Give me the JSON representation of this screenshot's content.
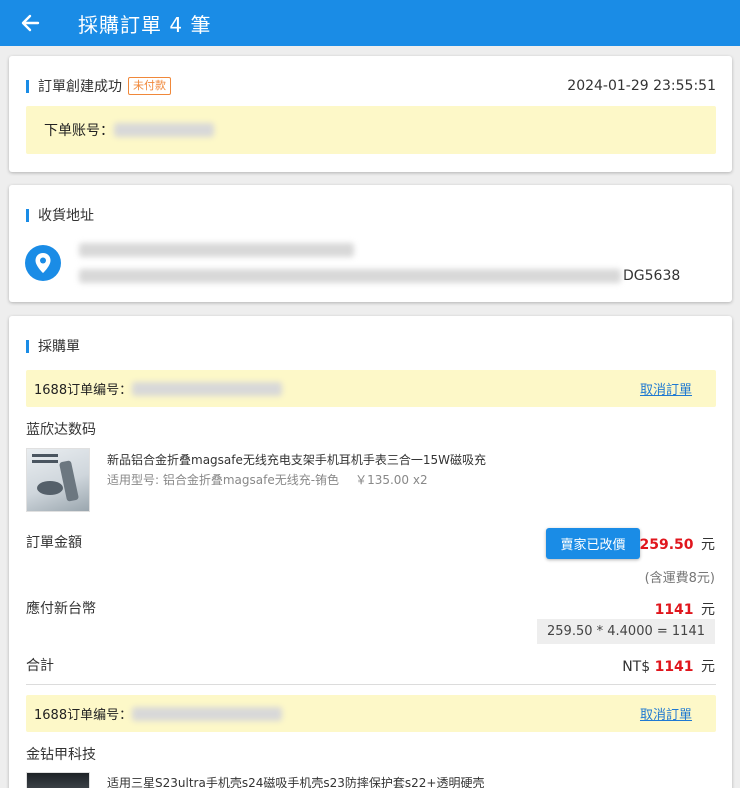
{
  "header": {
    "title": "採購訂單 4 筆"
  },
  "order": {
    "status_label": "訂單創建成功",
    "status_badge": "未付款",
    "datetime": "2024-01-29 23:55:51",
    "account_label": "下单账号："
  },
  "address": {
    "section_title": "收貨地址",
    "suffix": "DG5638"
  },
  "purchase": {
    "section_title": "採購單",
    "orders": [
      {
        "order_no_label": "1688订单编号：",
        "cancel_label": "取消訂單",
        "shop_name": "蓝欣达数码",
        "product_title": "新品铝合金折叠magsafe无线充电支架手机耳机手表三合一15W磁吸充",
        "product_spec": "适用型号: 铝合金折叠magsafe无线充-铕色",
        "product_price": "￥135.00 x2",
        "amount_label": "訂單金額",
        "price_changed_button": "賣家已改價",
        "amount_value": "259.50",
        "amount_unit": "元",
        "shipping_note": "(含運費8元)",
        "twd_label": "應付新台幣",
        "twd_value": "1141",
        "twd_unit": "元",
        "formula": "259.50 * 4.4000 = 1141",
        "total_label": "合計",
        "total_currency": "NT$",
        "total_value": "1141",
        "total_unit": "元"
      },
      {
        "order_no_label": "1688订单编号：",
        "cancel_label": "取消訂單",
        "shop_name": "金钻甲科技",
        "product_title": "适用三星S23ultra手机壳s24磁吸手机壳s23防摔保护套s22+透明硬壳"
      }
    ]
  },
  "colors": {
    "primary": "#1a8ce6",
    "price_red": "#e0161d",
    "badge_orange": "#f0883a",
    "highlight_yellow": "#fdf8c8"
  },
  "icons": {
    "back": "arrow-left-icon",
    "location": "location-pin-icon"
  }
}
